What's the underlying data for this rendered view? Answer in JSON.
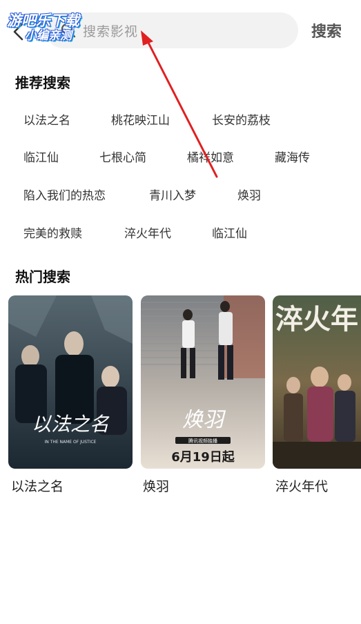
{
  "watermark": {
    "line1": "游吧乐下载",
    "line2": "小编亲测"
  },
  "search": {
    "placeholder": "搜索影视",
    "button": "搜索"
  },
  "recommended": {
    "title": "推荐搜索",
    "items": [
      "以法之名",
      "桃花映江山",
      "长安的荔枝",
      "临江仙",
      "七根心简",
      "橘祥如意",
      "藏海传",
      "陷入我们的热恋",
      "青川入梦",
      "焕羽",
      "完美的救赎",
      "淬火年代",
      "临江仙"
    ]
  },
  "hot": {
    "title": "热门搜索",
    "items": [
      {
        "title": "以法之名",
        "poster_text": "以法之名",
        "poster_subtext": "IN THE NAME OF JUSTICE",
        "palette": {
          "top": "#4a5a66",
          "bottom": "#1d2a34"
        }
      },
      {
        "title": "焕羽",
        "poster_text": "焕羽",
        "poster_date": "6月19日起",
        "poster_badge": "腾讯视频独播",
        "palette": {
          "top": "#8a8d90",
          "bottom": "#d9cfc4"
        }
      },
      {
        "title": "淬火年代",
        "poster_text": "淬火年",
        "palette": {
          "top": "#5e6a4d",
          "bottom": "#6e5a3e"
        }
      }
    ]
  },
  "colors": {
    "accent_arrow": "#e02020",
    "search_bg": "#f2f2f2",
    "placeholder": "#9a9a9a"
  },
  "icons": {
    "back": "chevron-left-icon",
    "search": "search-icon"
  }
}
